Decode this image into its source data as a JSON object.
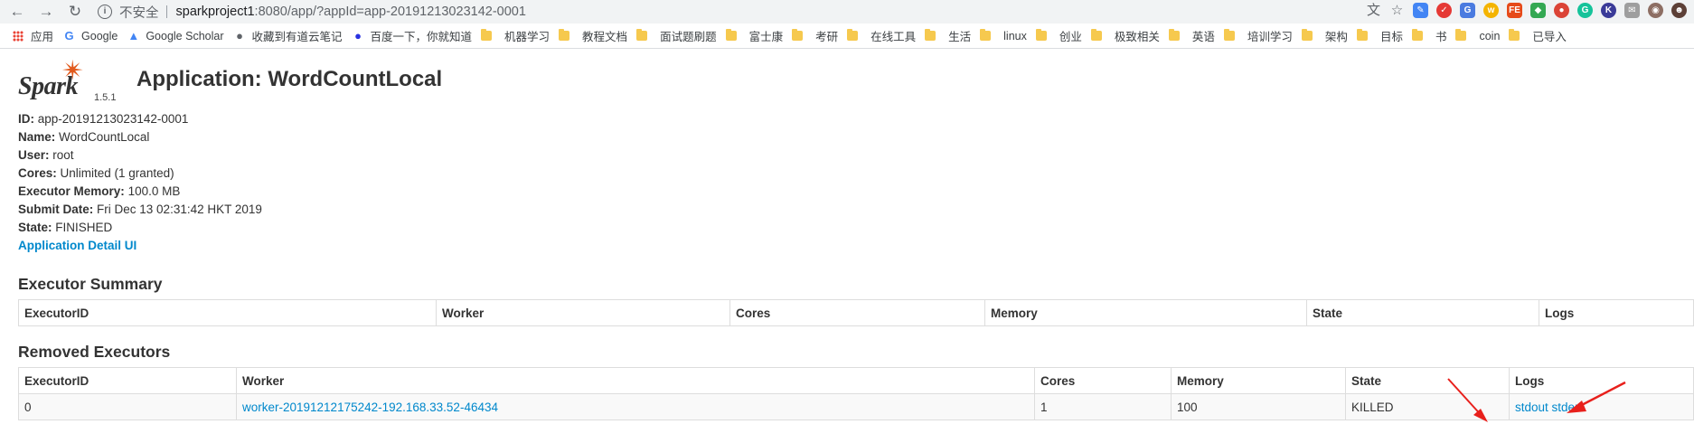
{
  "browser": {
    "security_label": "不安全",
    "url_host": "sparkproject1",
    "url_rest": ":8080/app/?appId=app-20191213023142-0001"
  },
  "bookmarks": [
    {
      "label": "应用",
      "kind": "apps"
    },
    {
      "label": "Google",
      "kind": "google"
    },
    {
      "label": "Google Scholar",
      "kind": "scholar"
    },
    {
      "label": "收藏到有道云笔记",
      "kind": "web"
    },
    {
      "label": "百度一下，你就知道",
      "kind": "baidu"
    },
    {
      "label": "机器学习",
      "kind": "folder"
    },
    {
      "label": "教程文档",
      "kind": "folder"
    },
    {
      "label": "面试题刷题",
      "kind": "folder"
    },
    {
      "label": "富士康",
      "kind": "folder"
    },
    {
      "label": "考研",
      "kind": "folder"
    },
    {
      "label": "在线工具",
      "kind": "folder"
    },
    {
      "label": "生活",
      "kind": "folder"
    },
    {
      "label": "linux",
      "kind": "folder"
    },
    {
      "label": "创业",
      "kind": "folder"
    },
    {
      "label": "极致相关",
      "kind": "folder"
    },
    {
      "label": "英语",
      "kind": "folder"
    },
    {
      "label": "培训学习",
      "kind": "folder"
    },
    {
      "label": "架构",
      "kind": "folder"
    },
    {
      "label": "目标",
      "kind": "folder"
    },
    {
      "label": "书",
      "kind": "folder"
    },
    {
      "label": "coin",
      "kind": "folder"
    },
    {
      "label": "已导入",
      "kind": "folder"
    }
  ],
  "header": {
    "logo_text": "Spark",
    "version": "1.5.1",
    "title": "Application: WordCountLocal"
  },
  "info": {
    "id_label": "ID:",
    "id_value": "app-20191213023142-0001",
    "name_label": "Name:",
    "name_value": "WordCountLocal",
    "user_label": "User:",
    "user_value": "root",
    "cores_label": "Cores:",
    "cores_value": "Unlimited (1 granted)",
    "mem_label": "Executor Memory:",
    "mem_value": "100.0 MB",
    "submit_label": "Submit Date:",
    "submit_value": "Fri Dec 13 02:31:42 HKT 2019",
    "state_label": "State:",
    "state_value": "FINISHED",
    "detail_link": "Application Detail UI"
  },
  "executor_summary": {
    "heading": "Executor Summary",
    "columns": [
      "ExecutorID",
      "Worker",
      "Cores",
      "Memory",
      "State",
      "Logs"
    ]
  },
  "removed_executors": {
    "heading": "Removed Executors",
    "columns": [
      "ExecutorID",
      "Worker",
      "Cores",
      "Memory",
      "State",
      "Logs"
    ],
    "rows": [
      {
        "id": "0",
        "worker": "worker-20191212175242-192.168.33.52-46434",
        "cores": "1",
        "memory": "100",
        "state": "KILLED",
        "stdout": "stdout",
        "stderr": "stderr"
      }
    ]
  },
  "colors": {
    "accent_link": "#0088cc",
    "annotation_arrow": "#e8201c",
    "spark_orange": "#e25a1c"
  }
}
